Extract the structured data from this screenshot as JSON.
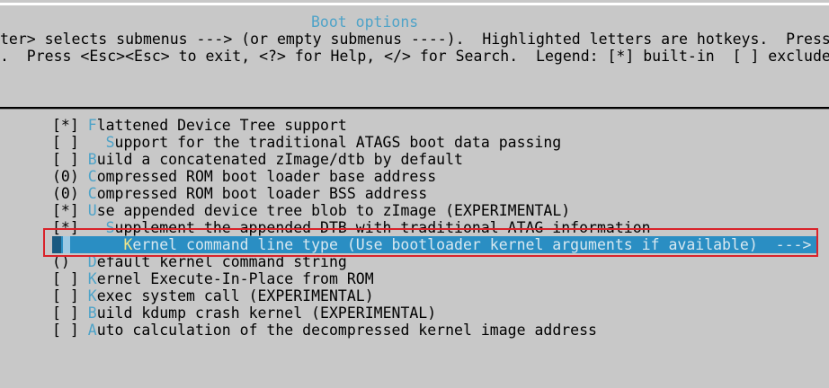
{
  "title": "Boot options",
  "help_line_1": "ter> selects submenus ---> (or empty submenus ----).  Highlighted letters are hotkeys.  Press",
  "help_line_2": ".  Press <Esc><Esc> to exit, <?> for Help, </> for Search.  Legend: [*] built-in  [ ] exclude",
  "items": [
    {
      "prefix": "[*] ",
      "hotkey": "F",
      "rest": "lattened Device Tree support"
    },
    {
      "prefix": "[ ]   ",
      "hotkey": "S",
      "rest": "upport for the traditional ATAGS boot data passing"
    },
    {
      "prefix": "[ ] ",
      "hotkey": "B",
      "rest": "uild a concatenated zImage/dtb by default"
    },
    {
      "prefix": "(0) ",
      "hotkey": "C",
      "rest": "ompressed ROM boot loader base address"
    },
    {
      "prefix": "(0) ",
      "hotkey": "C",
      "rest": "ompressed ROM boot loader BSS address"
    },
    {
      "prefix": "[*] ",
      "hotkey": "U",
      "rest": "se appended device tree blob to zImage (EXPERIMENTAL)"
    },
    {
      "prefix": "[*]   ",
      "hotkey": "S",
      "rest": "upplement the appended DTB with traditional ATAG information"
    },
    {
      "prefix": "        ",
      "hotkey": "K",
      "rest": "ernel command line type (Use bootloader kernel arguments if available)  --->",
      "selected": true
    },
    {
      "prefix": "()  ",
      "hotkey": "D",
      "rest": "efault kernel command string"
    },
    {
      "prefix": "[ ] ",
      "hotkey": "K",
      "rest": "ernel Execute-In-Place from ROM"
    },
    {
      "prefix": "[ ] ",
      "hotkey": "K",
      "rest": "exec system call (EXPERIMENTAL)"
    },
    {
      "prefix": "[ ] ",
      "hotkey": "B",
      "rest": "uild kdump crash kernel (EXPERIMENTAL)"
    },
    {
      "prefix": "[ ] ",
      "hotkey": "A",
      "rest": "uto calculation of the decompressed kernel image address"
    }
  ]
}
